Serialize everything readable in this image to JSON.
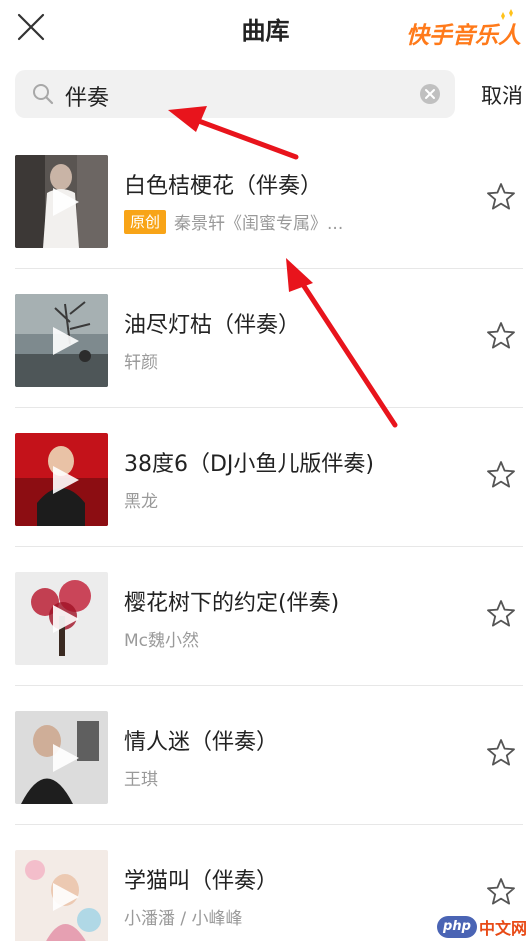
{
  "header": {
    "title": "曲库",
    "brand": "快手音乐人",
    "close_icon": "close-icon"
  },
  "search": {
    "value": "伴奏",
    "cancel_label": "取消"
  },
  "songs": [
    {
      "title": "白色桔梗花（伴奏）",
      "badge": "原创",
      "artist": "秦景轩《闺蜜专属》..."
    },
    {
      "title": "油尽灯枯（伴奏）",
      "badge": "",
      "artist": "轩颜"
    },
    {
      "title": "38度6（DJ小鱼儿版伴奏)",
      "badge": "",
      "artist": "黑龙"
    },
    {
      "title": "樱花树下的约定(伴奏)",
      "badge": "",
      "artist": "Mc魏小然"
    },
    {
      "title": "情人迷（伴奏）",
      "badge": "",
      "artist": "王琪"
    },
    {
      "title": "学猫叫（伴奏）",
      "badge": "",
      "artist": "小潘潘 / 小峰峰"
    }
  ],
  "colors": {
    "accent": "#ff7a1a",
    "badge": "#f8a417",
    "annotation": "#e8141c"
  },
  "watermark": {
    "logo": "php",
    "text": "中文网"
  }
}
